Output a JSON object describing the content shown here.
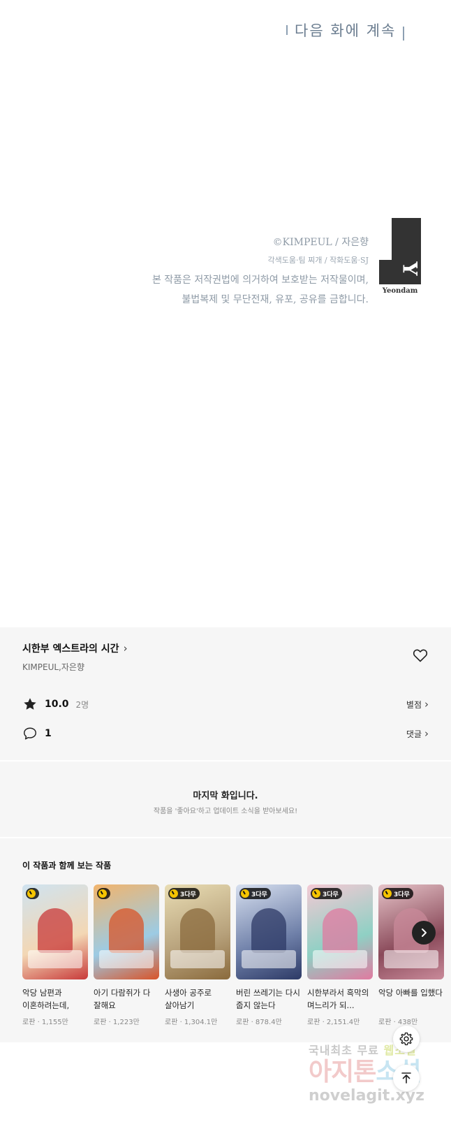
{
  "comic": {
    "continue_text": "다음 화에 계속",
    "copyright_line1": "©KIMPEUL / 자은향",
    "copyright_line2": "각색도움·팀 찌개 / 작화도움·SJ",
    "copyright_line3": "본 작품은 저작권법에 의거하여 보호받는 저작물이며,",
    "copyright_line4": "불법복제 및 무단전재, 유포, 공유를 금합니다.",
    "publisher_name": "Yeondam"
  },
  "series": {
    "title": "시한부 엑스트라의 시간",
    "author": "KIMPEUL,자은향",
    "rating": "10.0",
    "rating_count": "2명",
    "rating_link": "별점",
    "comment_count": "1",
    "comment_link": "댓글"
  },
  "notice": {
    "title": "마지막 화입니다.",
    "subtitle": "작품을 '좋아요'하고 업데이트 소식을 받아보세요!"
  },
  "recommend": {
    "heading": "이 작품과 함께 보는 작품",
    "items": [
      {
        "title": "악당 남편과 이혼하려는데, 아이...",
        "meta": "로판 · 1,155만",
        "badge": "",
        "colors": [
          "#cfe3f0",
          "#f3d7b4",
          "#c83a3a"
        ]
      },
      {
        "title": "아기 다람쥐가 다 잘해요",
        "meta": "로판 · 1,223만",
        "badge": "",
        "colors": [
          "#f2b46c",
          "#9ccbe4",
          "#d8542a"
        ]
      },
      {
        "title": "사생아 공주로 살아남기",
        "meta": "로판 · 1,304.1만",
        "badge": "3다무",
        "colors": [
          "#e9ddb4",
          "#b6a07a",
          "#8a6a3c"
        ]
      },
      {
        "title": "버린 쓰레기는 다시 줍지 않는다",
        "meta": "로판 · 878.4만",
        "badge": "3다무",
        "colors": [
          "#d6dfef",
          "#6e7fa8",
          "#2d3a66"
        ]
      },
      {
        "title": "시한부라서 흑막의 며느리가 되...",
        "meta": "로판 · 2,151.4만",
        "badge": "3다무",
        "colors": [
          "#f4c9d4",
          "#8fd0c4",
          "#e07aa0"
        ]
      },
      {
        "title": "악당 아빠를 입했다",
        "meta": "로판 · 438만",
        "badge": "3다무",
        "colors": [
          "#e6c3c8",
          "#8a4a5a",
          "#c98a9a"
        ]
      }
    ]
  },
  "watermark": {
    "line1_a": "국내최초 무료",
    "line1_b": "웹소설",
    "line2_a": "아지톤",
    "line2_b": "소설",
    "line3": "novelagit.xyz"
  }
}
